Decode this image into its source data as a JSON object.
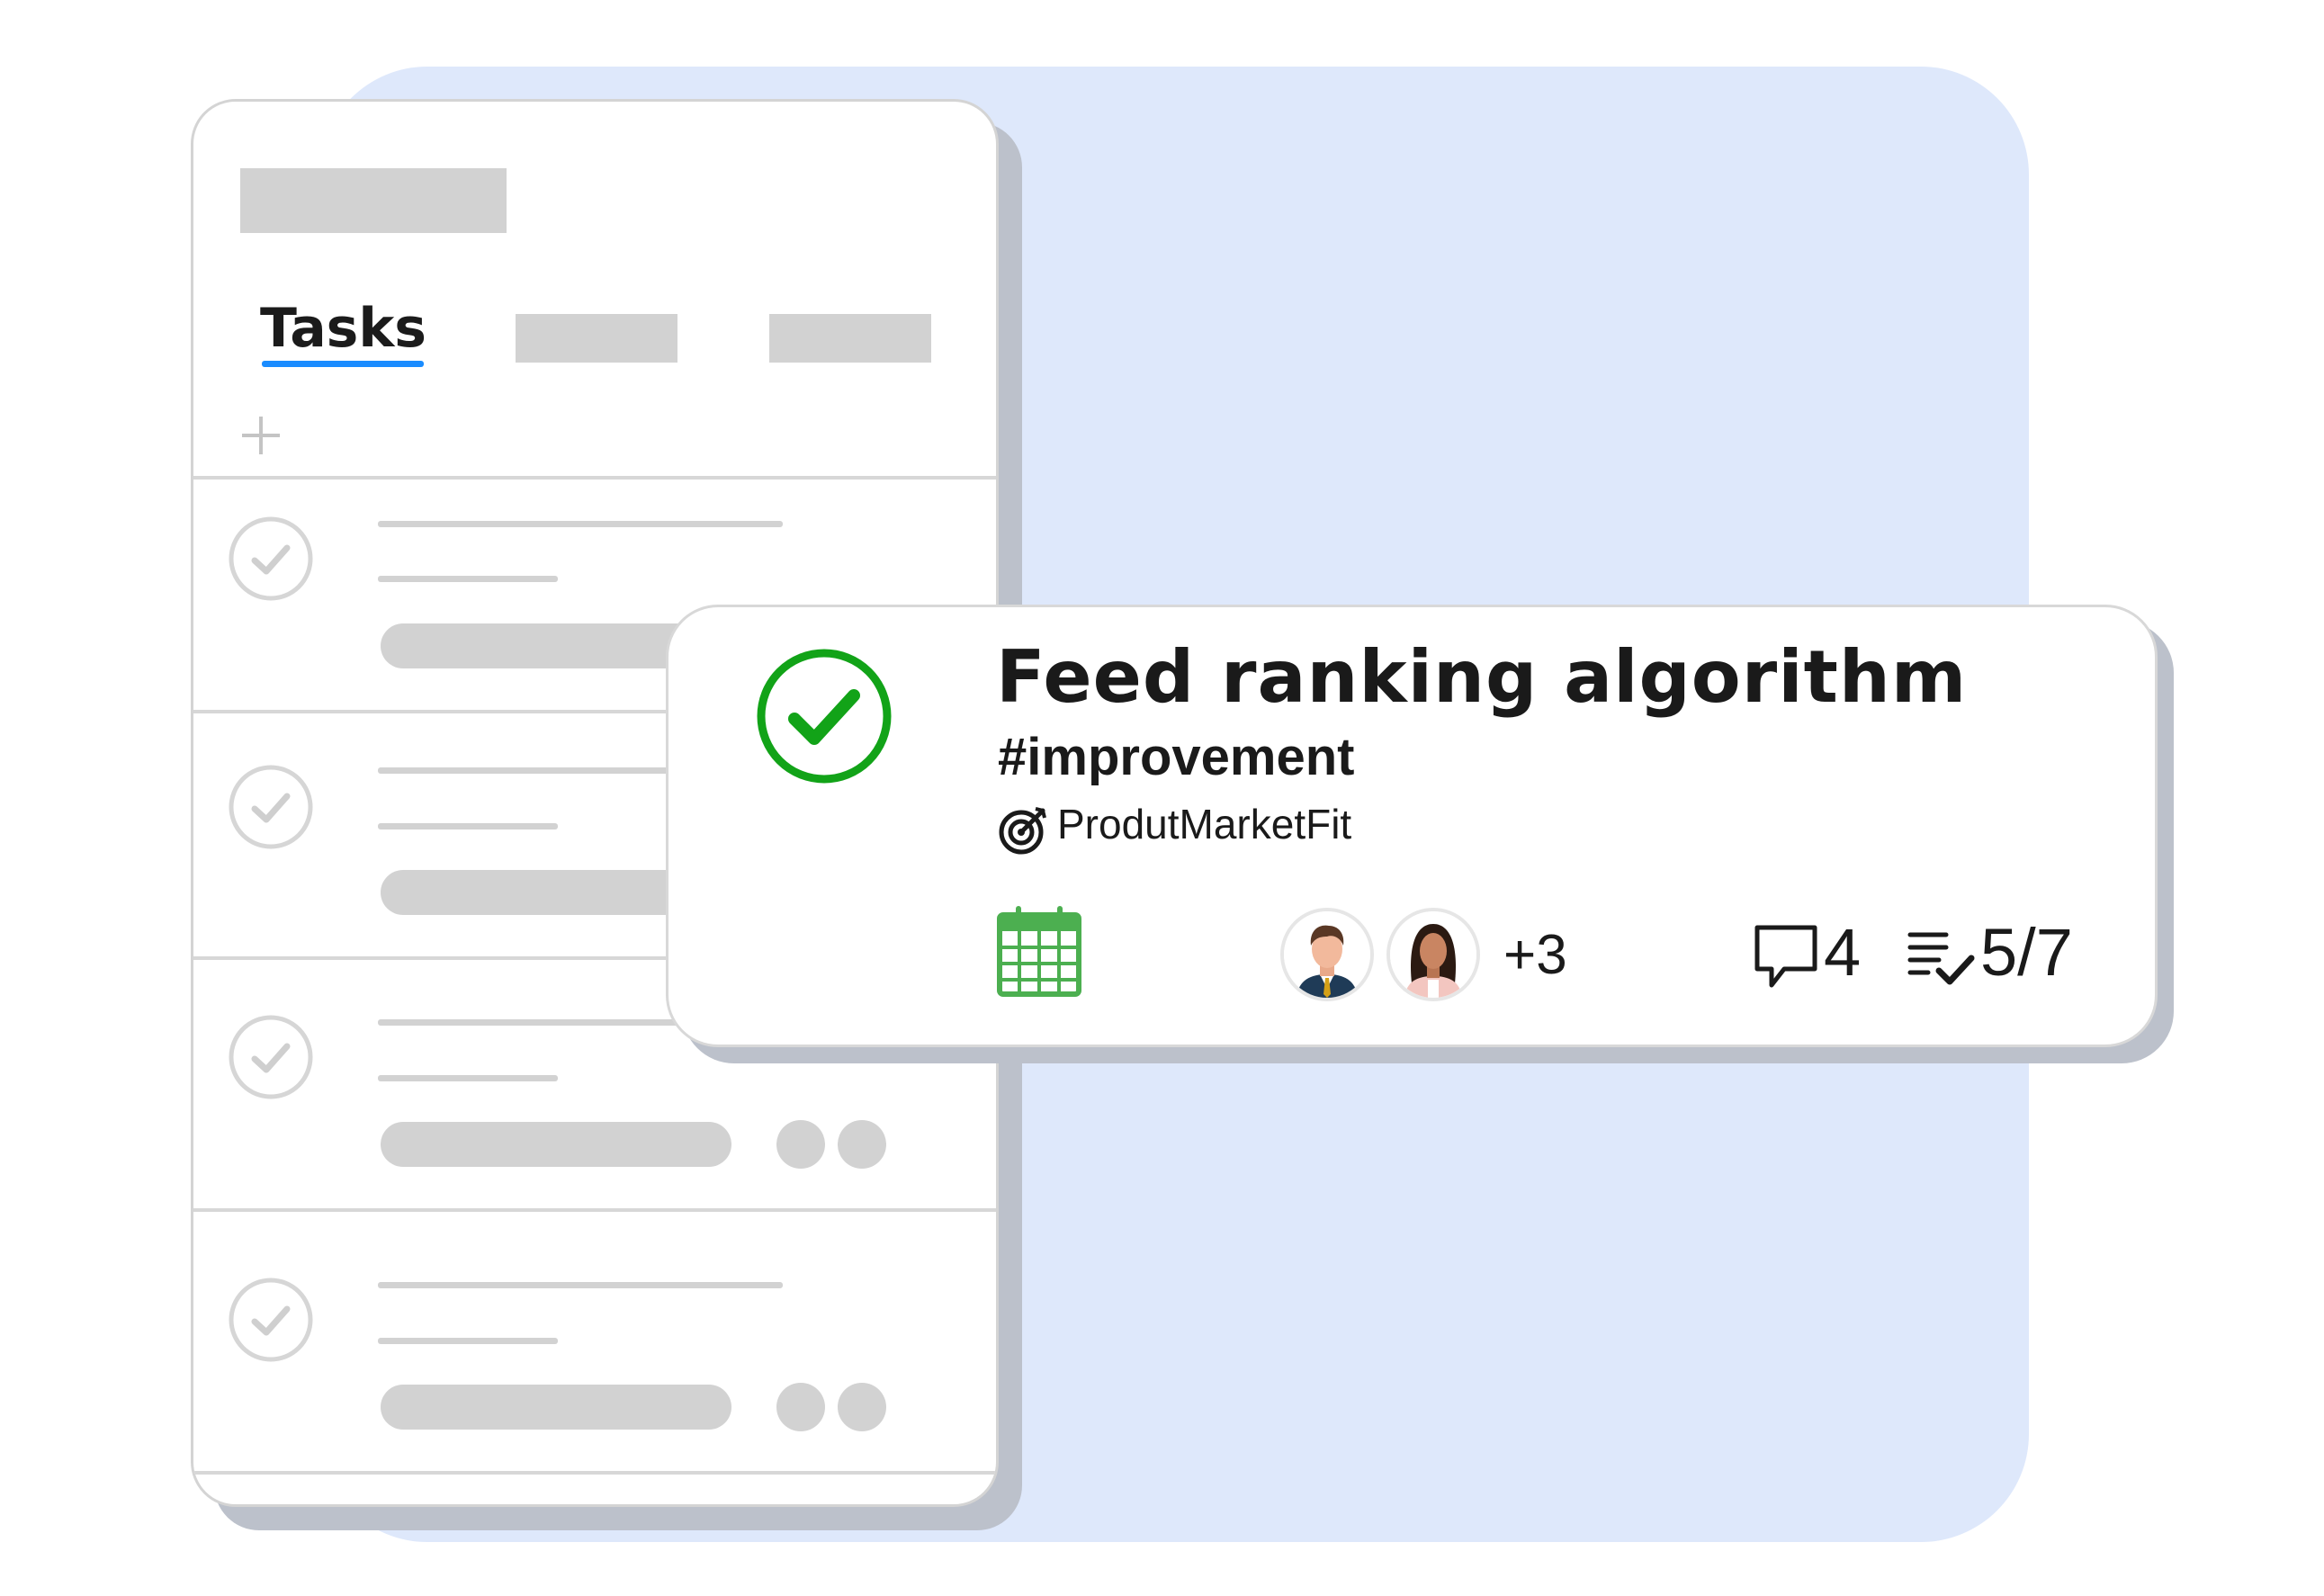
{
  "tabs": {
    "active_label": "Tasks"
  },
  "task_card": {
    "title": "Feed ranking algorithm",
    "tag": "#improvement",
    "goal": "ProdutMarketFit",
    "extra_assignees": "+3",
    "comments_count": "4",
    "checklist_progress": "5/7",
    "status": "completed"
  },
  "colors": {
    "accent_blue": "#1a8cff",
    "done_green": "#12a318",
    "calendar_green": "#4caf50",
    "background_panel": "#dee8fb"
  },
  "icons": [
    "plus-icon",
    "check-circle-icon",
    "target-icon",
    "calendar-icon",
    "comment-icon",
    "checklist-icon"
  ]
}
